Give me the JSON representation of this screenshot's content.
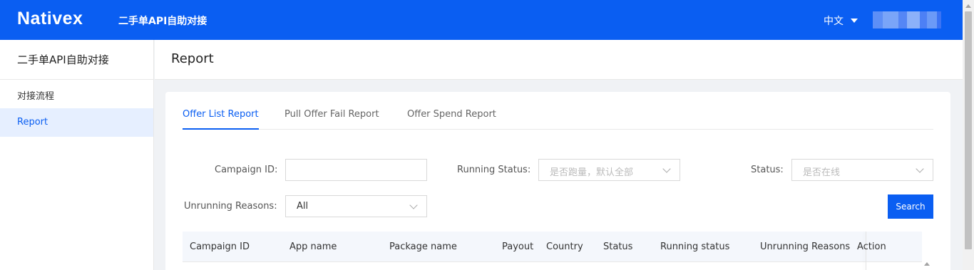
{
  "header": {
    "logo": "Nativex",
    "title": "二手单API自助对接",
    "language": "中文",
    "accent_color": "#0a5ef2"
  },
  "sidebar": {
    "heading": "二手单API自助对接",
    "items": [
      {
        "label": "对接流程",
        "active": false
      },
      {
        "label": "Report",
        "active": true
      }
    ]
  },
  "page": {
    "title": "Report"
  },
  "tabs": [
    {
      "label": "Offer List Report",
      "active": true
    },
    {
      "label": "Pull Offer Fail Report",
      "active": false
    },
    {
      "label": "Offer Spend Report",
      "active": false
    }
  ],
  "filters": {
    "campaign_id": {
      "label": "Campaign ID:",
      "value": ""
    },
    "running_status": {
      "label": "Running Status:",
      "placeholder": "是否跑量，默认全部"
    },
    "status": {
      "label": "Status:",
      "placeholder": "是否在线"
    },
    "unrunning_reasons": {
      "label": "Unrunning Reasons:",
      "value": "All"
    },
    "search_label": "Search"
  },
  "table": {
    "columns": [
      "Campaign ID",
      "App name",
      "Package name",
      "Payout",
      "Country",
      "Status",
      "Running status",
      "Unrunning Reasons",
      "Action"
    ]
  }
}
